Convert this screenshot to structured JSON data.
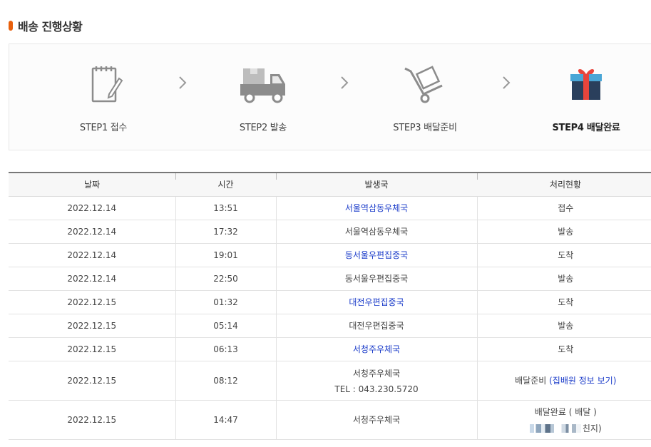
{
  "section": {
    "title": "배송 진행상황"
  },
  "steps": [
    {
      "label": "STEP1 접수",
      "icon": "notepad-pencil-icon"
    },
    {
      "label": "STEP2 발송",
      "icon": "delivery-truck-icon"
    },
    {
      "label": "STEP3 배달준비",
      "icon": "hand-truck-icon"
    },
    {
      "label": "STEP4 배달완료",
      "icon": "gift-box-icon",
      "active": true
    }
  ],
  "table": {
    "headers": [
      "날짜",
      "시간",
      "발생국",
      "처리현황"
    ],
    "rows": [
      {
        "date": "2022.12.14",
        "time": "13:51",
        "office": "서울역삼동우체국",
        "status": "접수"
      },
      {
        "date": "2022.12.14",
        "time": "17:32",
        "office": "서울역삼동우체국",
        "status": "발송"
      },
      {
        "date": "2022.12.14",
        "time": "19:01",
        "office": "동서울우편집중국",
        "status": "도착"
      },
      {
        "date": "2022.12.14",
        "time": "22:50",
        "office": "동서울우편집중국",
        "status": "발송"
      },
      {
        "date": "2022.12.15",
        "time": "01:32",
        "office": "대전우편집중국",
        "status": "도착"
      },
      {
        "date": "2022.12.15",
        "time": "05:14",
        "office": "대전우편집중국",
        "status": "발송"
      },
      {
        "date": "2022.12.15",
        "time": "06:13",
        "office": "서청주우체국",
        "status": "도착"
      },
      {
        "date": "2022.12.15",
        "time": "08:12",
        "office": "서청주우체국",
        "office_tel": "TEL : 043.230.5720",
        "status": "배달준비",
        "status_link": "(집배원 정보 보기)"
      },
      {
        "date": "2022.12.15",
        "time": "14:47",
        "office": "서청주우체국",
        "status": "배달완료 ( 배달 )",
        "status_suffix": "친지)"
      }
    ]
  },
  "colors": {
    "accent": "#e8600c",
    "link": "#1a3bc9",
    "gift_red": "#e8453c",
    "gift_navy": "#2a3f5c",
    "gift_blue": "#4aa6d6"
  }
}
